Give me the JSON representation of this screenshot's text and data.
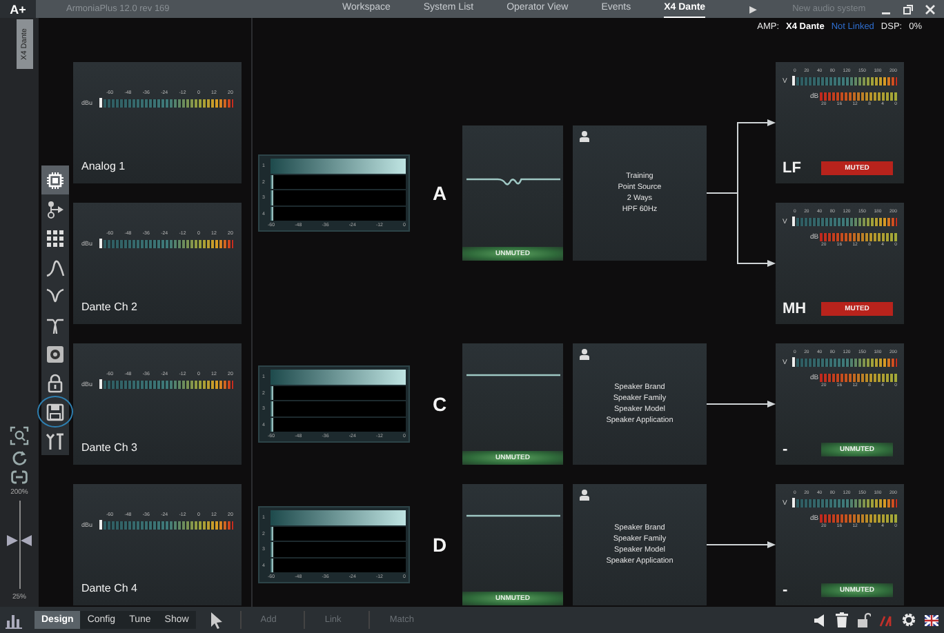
{
  "title_bar": {
    "logo": "A+",
    "app_name": "ArmoniaPlus 12.0 rev 169",
    "tabs": [
      {
        "label": "Workspace",
        "selected": false
      },
      {
        "label": "System List",
        "selected": false
      },
      {
        "label": "Operator View",
        "selected": false
      },
      {
        "label": "Events",
        "selected": false
      },
      {
        "label": "X4 Dante",
        "selected": true
      }
    ],
    "next": "▶",
    "system_name": "New audio system"
  },
  "status": {
    "amp_label": "AMP:",
    "amp_value": "X4 Dante",
    "link": "Not Linked",
    "dsp_label": "DSP:",
    "dsp_value": "0%"
  },
  "side_tab": "X4 Dante",
  "tools": [
    {
      "kind": "chip",
      "selected": true,
      "focused": false
    },
    {
      "kind": "route",
      "selected": false,
      "focused": false
    },
    {
      "kind": "grid",
      "selected": false,
      "focused": false
    },
    {
      "kind": "bell",
      "selected": false,
      "focused": false
    },
    {
      "kind": "notch",
      "selected": false,
      "focused": false
    },
    {
      "kind": "filter",
      "selected": false,
      "focused": false
    },
    {
      "kind": "speaker",
      "selected": false,
      "focused": false
    },
    {
      "kind": "lock",
      "selected": false,
      "focused": false
    },
    {
      "kind": "save",
      "selected": false,
      "focused": true
    },
    {
      "kind": "tools",
      "selected": false,
      "focused": false
    }
  ],
  "zoom": {
    "max": "200%",
    "min": "25%",
    "level": 0.55
  },
  "inputs": [
    {
      "name": "Analog 1",
      "unit": "dBu",
      "scale": [
        "-60",
        "-48",
        "-36",
        "-24",
        "-12",
        "0",
        "12",
        "20"
      ]
    },
    {
      "name": "Dante Ch 2",
      "unit": "dBu",
      "scale": [
        "-60",
        "-48",
        "-36",
        "-24",
        "-12",
        "0",
        "12",
        "20"
      ]
    },
    {
      "name": "Dante Ch 3",
      "unit": "dBu",
      "scale": [
        "-60",
        "-48",
        "-36",
        "-24",
        "-12",
        "0",
        "12",
        "20"
      ]
    },
    {
      "name": "Dante Ch 4",
      "unit": "dBu",
      "scale": [
        "-60",
        "-48",
        "-36",
        "-24",
        "-12",
        "0",
        "12",
        "20"
      ]
    }
  ],
  "channels": [
    {
      "letter": "A",
      "graph": {
        "rows": [
          {
            "label": "1",
            "level": 1
          },
          {
            "label": "2",
            "level": 0
          },
          {
            "label": "3",
            "level": 0
          },
          {
            "label": "4",
            "level": 0
          }
        ],
        "ticks": [
          "-60",
          "-48",
          "-36",
          "-24",
          "-12",
          "0"
        ]
      },
      "kind": "notched",
      "muted": false,
      "mute_label": "UNMUTED",
      "info": [
        "Training",
        "Point Source",
        "2 Ways",
        "HPF 60Hz"
      ],
      "outputs": [
        {
          "name": "LF",
          "muted": true,
          "mute_label": "MUTED",
          "v_unit": "V",
          "v_scale": [
            "0",
            "20",
            "40",
            "80",
            "120",
            "150",
            "180",
            "200"
          ],
          "db_unit": "dB",
          "db_scale": [
            "20",
            "16",
            "12",
            "8",
            "4",
            "0"
          ]
        },
        {
          "name": "MH",
          "muted": true,
          "mute_label": "MUTED",
          "v_unit": "V",
          "v_scale": [
            "0",
            "20",
            "40",
            "80",
            "120",
            "150",
            "180",
            "200"
          ],
          "db_unit": "dB",
          "db_scale": [
            "20",
            "16",
            "12",
            "8",
            "4",
            "0"
          ]
        }
      ]
    },
    {
      "letter": "C",
      "graph": {
        "rows": [
          {
            "label": "1",
            "level": 1
          },
          {
            "label": "2",
            "level": 0
          },
          {
            "label": "3",
            "level": 0
          },
          {
            "label": "4",
            "level": 0
          }
        ],
        "ticks": [
          "-60",
          "-48",
          "-36",
          "-24",
          "-12",
          "0"
        ]
      },
      "kind": "flat",
      "muted": false,
      "mute_label": "UNMUTED",
      "info": [
        "Speaker Brand",
        "Speaker Family",
        "Speaker Model",
        "Speaker Application"
      ],
      "outputs": [
        {
          "name": "-",
          "muted": false,
          "mute_label": "UNMUTED",
          "v_unit": "V",
          "v_scale": [
            "0",
            "20",
            "40",
            "80",
            "120",
            "150",
            "180",
            "200"
          ],
          "db_unit": "dB",
          "db_scale": [
            "20",
            "16",
            "12",
            "8",
            "4",
            "0"
          ]
        }
      ]
    },
    {
      "letter": "D",
      "graph": {
        "rows": [
          {
            "label": "1",
            "level": 1
          },
          {
            "label": "2",
            "level": 0
          },
          {
            "label": "3",
            "level": 0
          },
          {
            "label": "4",
            "level": 0
          }
        ],
        "ticks": [
          "-60",
          "-48",
          "-36",
          "-24",
          "-12",
          "0"
        ]
      },
      "kind": "flat",
      "muted": false,
      "mute_label": "UNMUTED",
      "info": [
        "Speaker Brand",
        "Speaker Family",
        "Speaker Model",
        "Speaker Application"
      ],
      "outputs": [
        {
          "name": "-",
          "muted": false,
          "mute_label": "UNMUTED",
          "v_unit": "V",
          "v_scale": [
            "0",
            "20",
            "40",
            "80",
            "120",
            "150",
            "180",
            "200"
          ],
          "db_unit": "dB",
          "db_scale": [
            "20",
            "16",
            "12",
            "8",
            "4",
            "0"
          ]
        }
      ]
    }
  ],
  "mode_tabs": [
    {
      "label": "Design",
      "selected": true
    },
    {
      "label": "Config",
      "selected": false
    },
    {
      "label": "Tune",
      "selected": false
    },
    {
      "label": "Show",
      "selected": false
    }
  ],
  "actions": [
    {
      "label": "Add",
      "disabled": true
    },
    {
      "label": "Link",
      "disabled": true
    },
    {
      "label": "Match",
      "disabled": true
    }
  ]
}
